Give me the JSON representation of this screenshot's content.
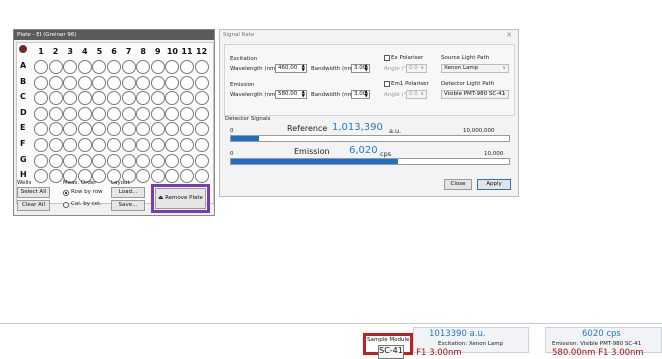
{
  "plate": {
    "title": "Plate - EI (Greiner 96)",
    "columns": [
      "1",
      "2",
      "3",
      "4",
      "5",
      "6",
      "7",
      "8",
      "9",
      "10",
      "11",
      "12"
    ],
    "rows": [
      "A",
      "B",
      "C",
      "D",
      "E",
      "F",
      "G",
      "H"
    ],
    "wells_label": "Wells",
    "select_all": "Select All",
    "clear_all": "Clear All",
    "meas_order_label": "Meas. Order",
    "row_by_row": "Row by row",
    "col_by_col": "Col. by col.",
    "layout_label": "Layout",
    "load": "Load...",
    "save": "Save...",
    "remove_plate": "Remove Plate",
    "remove_icon": "eject-icon"
  },
  "signal_rate": {
    "title": "Signal Rate",
    "close_glyph": "✕",
    "excitation_label": "Excitation",
    "wavelength_label": "Wavelength (nm):",
    "excitation_wavelength": "460.00",
    "bandwidth_label": "Bandwidth (nm):",
    "excitation_bandwidth": "3.00",
    "ex_polariser_label": "Ex Polariser",
    "ex_angle_label": "Angle (°):",
    "ex_angle_value": "0.0",
    "source_path_label": "Source Light Path",
    "source_path_value": "Xenon Lamp",
    "emission_label": "Emission",
    "emission_wavelength": "580.00",
    "emission_bandwidth": "3.00",
    "em_polariser_label": "Em1 Polariser",
    "em_angle_value": "0.0",
    "detector_path_label": "Detector Light Path",
    "detector_path_value": "Visible PMT-980 SC-41",
    "detector_signals_label": "Detector Signals",
    "reference_label": "Reference",
    "reference_value": "1,013,390",
    "reference_unit": "a.u.",
    "reference_min": "0",
    "reference_max": "10,000,000",
    "reference_fraction": 0.1013,
    "emission_signal_label": "Emission",
    "emission_value": "6,020",
    "emission_unit": "cps",
    "emission_min": "0",
    "emission_max": "10,000",
    "emission_fraction": 0.602,
    "close": "Close",
    "apply": "Apply"
  },
  "status": {
    "reference_readout": "1013390 a.u.",
    "sample_module_label": "Sample Module",
    "sample_module_value": "SC-41",
    "excitation_info": "Excitation: Xenon Lamp",
    "excitation_setting": "460.00nm  F1  3.00nm",
    "emission_readout": "6020 cps",
    "emission_info": "Emission: Visible PMT-980 SC-41",
    "emission_setting": "580.00nm  F1  3.00nm"
  },
  "colors": {
    "accent_blue": "#2079cf",
    "bar_blue": "#1f6fc6",
    "highlight_purple": "#7a3bb0",
    "highlight_red": "#c0201f",
    "red_text": "#b01010"
  }
}
